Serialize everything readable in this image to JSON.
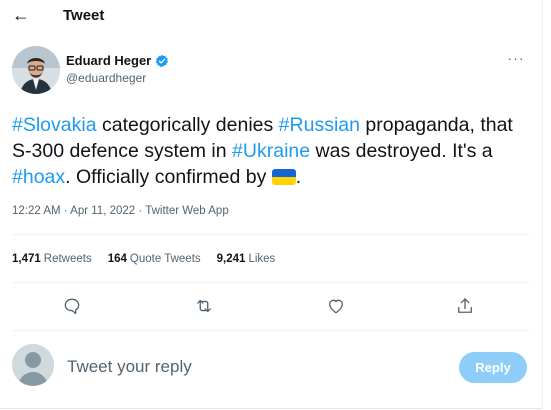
{
  "header": {
    "back_icon": "arrow-left-icon",
    "title": "Tweet"
  },
  "author": {
    "name": "Eduard Heger",
    "handle": "@eduardheger",
    "verified": true,
    "more_icon": "more-horizontal-icon"
  },
  "tweet": {
    "segments": [
      {
        "text": "#Slovakia",
        "hashtag": true
      },
      {
        "text": " categorically denies ",
        "hashtag": false
      },
      {
        "text": "#Russian",
        "hashtag": true
      },
      {
        "text": " propaganda, that S-300 defence system in ",
        "hashtag": false
      },
      {
        "text": "#Ukraine",
        "hashtag": true
      },
      {
        "text": " was destroyed. It's a ",
        "hashtag": false
      },
      {
        "text": "#hoax",
        "hashtag": true
      },
      {
        "text": ". Officially confirmed by ",
        "hashtag": false
      },
      {
        "text": ".",
        "hashtag": false
      }
    ],
    "emoji": "ukraine-flag-emoji",
    "timestamp": "12:22 AM · Apr 11, 2022 · Twitter Web App"
  },
  "stats": [
    {
      "count": "1,471",
      "label": "Retweets"
    },
    {
      "count": "164",
      "label": "Quote Tweets"
    },
    {
      "count": "9,241",
      "label": "Likes"
    }
  ],
  "actions": [
    "reply-icon",
    "retweet-icon",
    "like-icon",
    "share-icon"
  ],
  "reply": {
    "placeholder": "Tweet your reply",
    "button_label": "Reply"
  },
  "colors": {
    "accent": "#1d9bf0",
    "reply_button": "#8ecdf8",
    "text": "#0f1419",
    "secondary_text": "#536471",
    "flag_blue": "#1565d8",
    "flag_yellow": "#ffd400"
  }
}
